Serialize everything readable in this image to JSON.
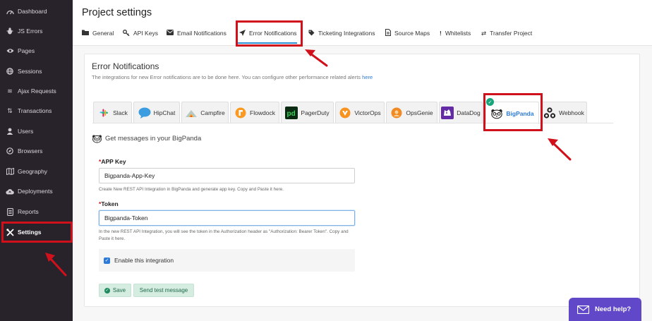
{
  "sidebar": {
    "items": [
      {
        "label": "Dashboard",
        "icon": "gauge-icon"
      },
      {
        "label": "JS Errors",
        "icon": "bug-icon"
      },
      {
        "label": "Pages",
        "icon": "eye-icon"
      },
      {
        "label": "Sessions",
        "icon": "globe-icon"
      },
      {
        "label": "Ajax Requests",
        "icon": "exchange-icon"
      },
      {
        "label": "Transactions",
        "icon": "sort-icon"
      },
      {
        "label": "Users",
        "icon": "user-icon"
      },
      {
        "label": "Browsers",
        "icon": "compass-icon"
      },
      {
        "label": "Geography",
        "icon": "map-icon"
      },
      {
        "label": "Deployments",
        "icon": "cloud-upload-icon"
      },
      {
        "label": "Reports",
        "icon": "document-icon"
      },
      {
        "label": "Settings",
        "icon": "tools-icon",
        "active": true
      }
    ]
  },
  "header": {
    "title": "Project settings",
    "tabs": [
      {
        "label": "General",
        "icon": "folder-icon"
      },
      {
        "label": "API Keys",
        "icon": "key-icon"
      },
      {
        "label": "Email Notifications",
        "icon": "envelope-icon"
      },
      {
        "label": "Error Notifications",
        "icon": "paper-plane-icon",
        "active": true
      },
      {
        "label": "Ticketing Integrations",
        "icon": "tag-icon"
      },
      {
        "label": "Source Maps",
        "icon": "file-icon"
      },
      {
        "label": "Whitelists",
        "icon": "exclamation-icon"
      },
      {
        "label": "Transfer Project",
        "icon": "swap-icon"
      }
    ]
  },
  "card": {
    "title": "Error Notifications",
    "description": "The integrations for new Error notifications are to be done here. You can configure other performance related alerts",
    "description_link": "here"
  },
  "integrations": [
    {
      "label": "Slack",
      "icon": "slack-logo"
    },
    {
      "label": "HipChat",
      "icon": "hipchat-logo"
    },
    {
      "label": "Campfire",
      "icon": "campfire-logo"
    },
    {
      "label": "Flowdock",
      "icon": "flowdock-logo"
    },
    {
      "label": "PagerDuty",
      "icon": "pagerduty-logo"
    },
    {
      "label": "VictorOps",
      "icon": "victorops-logo"
    },
    {
      "label": "OpsGenie",
      "icon": "opsgenie-logo"
    },
    {
      "label": "DataDog",
      "icon": "datadog-logo"
    },
    {
      "label": "BigPanda",
      "icon": "bigpanda-logo",
      "active": true
    },
    {
      "label": "Webhook",
      "icon": "webhook-logo"
    }
  ],
  "form": {
    "heading": "Get messages in your BigPanda",
    "app_key": {
      "required_mark": "*",
      "label": "APP Key",
      "value": "Bigpanda-App-Key",
      "help": "Create New REST API Integration in BigPanda and generate app key. Copy and Paste it here."
    },
    "token": {
      "required_mark": "*",
      "label": "Token",
      "value": "Bigpanda-Token",
      "help": "In the new REST API Integration, you will see the token in the Authorization header as \"Authorization: Bearer Token\". Copy and Paste it here."
    },
    "enable_label": "Enable this integration",
    "enabled": true,
    "save_label": "Save",
    "test_label": "Send test message"
  },
  "help_widget": {
    "label": "Need help?"
  },
  "colors": {
    "sidebar_bg": "#28222b",
    "accent_blue": "#2d8fd5",
    "highlight_red": "#d0111b",
    "help_purple": "#6048c8",
    "save_green": "#d5ece1"
  }
}
